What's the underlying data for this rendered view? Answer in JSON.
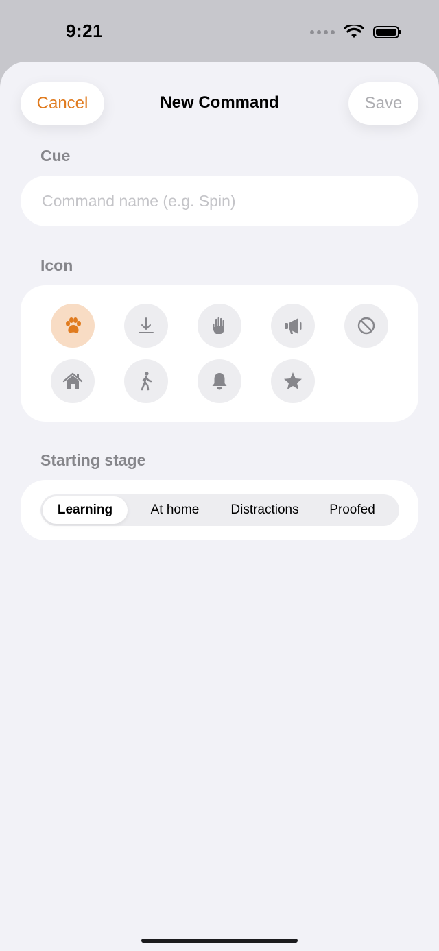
{
  "status_bar": {
    "time": "9:21"
  },
  "header": {
    "cancel_label": "Cancel",
    "title": "New Command",
    "save_label": "Save"
  },
  "cue": {
    "label": "Cue",
    "placeholder": "Command name (e.g. Spin)",
    "value": ""
  },
  "icon_section": {
    "label": "Icon",
    "selected": "paw-icon",
    "icons": [
      "paw-icon",
      "download-arrow-icon",
      "hand-icon",
      "megaphone-icon",
      "prohibited-icon",
      "house-icon",
      "walking-person-icon",
      "bell-icon",
      "star-icon"
    ]
  },
  "stage": {
    "label": "Starting stage",
    "options": [
      "Learning",
      "At home",
      "Distractions",
      "Proofed"
    ],
    "selected": "Learning"
  },
  "colors": {
    "accent": "#e07b1f",
    "icon_gray": "#86868b",
    "selected_bg": "#f8dcc4",
    "sheet_bg": "#f2f2f7"
  }
}
